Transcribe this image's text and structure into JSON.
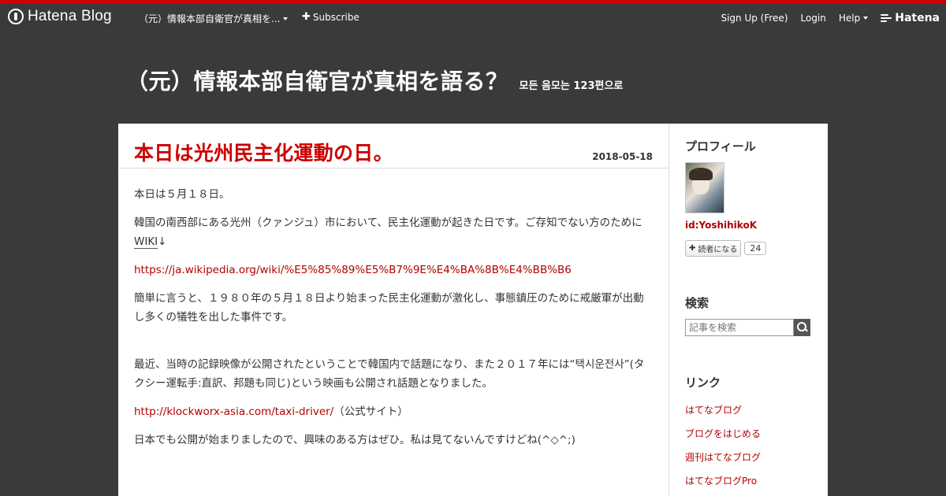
{
  "globalbar": {
    "logo_text": "Hatena Blog",
    "blog_select": "（元）情報本部自衛官が真相を...",
    "subscribe": "Subscribe",
    "signup": "Sign Up (Free)",
    "login": "Login",
    "help": "Help",
    "hatena": "Hatena"
  },
  "blog": {
    "title": "（元）情報本部自衛官が真相を語る？",
    "description": "모든 음모는 123편으로"
  },
  "entry": {
    "title": "本日は光州民主化運動の日。",
    "date": "2018-05-18",
    "p1": "本日は５月１８日。",
    "p2_text": "韓国の南西部にある光州（クァンジュ）市において、民主化運動が起きた日です。ご存知でない方のために",
    "p2_link": "WIKI",
    "p2_suffix": "↓",
    "wiki_url": "https://ja.wikipedia.org/wiki/%E5%85%89%E5%B7%9E%E4%BA%8B%E4%BB%B6",
    "p3": "簡単に言うと、１９８０年の５月１８日より始まった民主化運動が激化し、事態鎮圧のために戒厳軍が出動し多くの犠牲を出した事件です。",
    "p4": "最近、当時の記録映像が公開されたということで韓国内で話題になり、また２０１７年には“택시운전사”(タクシー運転手:直訳、邦題も同じ)という映画も公開され話題となりました。",
    "taxi_url": "http://klockworx-asia.com/taxi-driver/",
    "taxi_suffix": "（公式サイト）",
    "p5": "日本でも公開が始まりましたので、興味のある方はぜひ。私は見てないんですけどね(^◇^;)"
  },
  "sidebar": {
    "profile_title": "プロフィール",
    "profile_id": "id:YoshihikoK",
    "follow_label": "読者になる",
    "follow_count": "24",
    "search_title": "検索",
    "search_placeholder": "記事を検索",
    "links_title": "リンク",
    "links": [
      "はてなブログ",
      "ブログをはじめる",
      "週刊はてなブログ",
      "はてなブログPro"
    ]
  },
  "colors": {
    "accent": "#cc0000",
    "background": "#3a3a3a",
    "link": "#b30000"
  }
}
